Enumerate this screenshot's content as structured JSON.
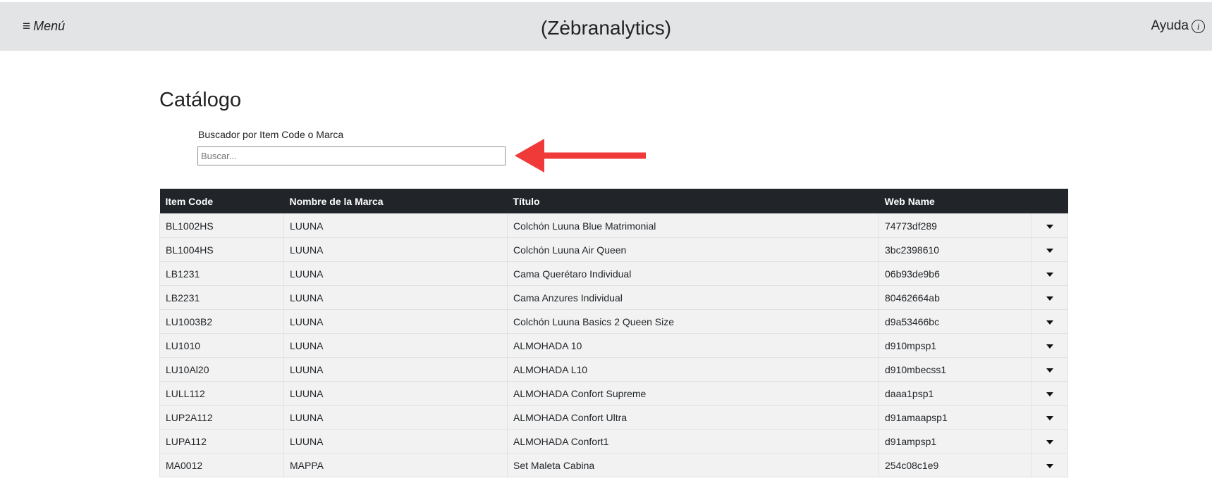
{
  "header": {
    "menu_icon": "hamburger-icon",
    "menu_label": "Menú",
    "brand": "(Zėbranalytics)",
    "help_label": "Ayuda",
    "help_icon": "info-circle-icon"
  },
  "page": {
    "title": "Catálogo"
  },
  "search": {
    "label": "Buscador por Item Code o Marca",
    "placeholder": "Buscar...",
    "value": ""
  },
  "annotation": {
    "arrow_color": "#f03a3a"
  },
  "table": {
    "columns": [
      "Item Code",
      "Nombre de la Marca",
      "Título",
      "Web Name"
    ],
    "rows": [
      {
        "item_code": "BL1002HS",
        "brand": "LUUNA",
        "title": "Colchón Luuna Blue Matrimonial",
        "web_name": "74773df289"
      },
      {
        "item_code": "BL1004HS",
        "brand": "LUUNA",
        "title": "Colchón Luuna Air Queen",
        "web_name": "3bc2398610"
      },
      {
        "item_code": "LB1231",
        "brand": "LUUNA",
        "title": "Cama Querétaro Individual",
        "web_name": "06b93de9b6"
      },
      {
        "item_code": "LB2231",
        "brand": "LUUNA",
        "title": "Cama Anzures Individual",
        "web_name": "80462664ab"
      },
      {
        "item_code": "LU1003B2",
        "brand": "LUUNA",
        "title": "Colchón Luuna Basics 2 Queen Size",
        "web_name": "d9a53466bc"
      },
      {
        "item_code": "LU1010",
        "brand": "LUUNA",
        "title": "ALMOHADA 10",
        "web_name": "d910mpsp1"
      },
      {
        "item_code": "LU10Al20",
        "brand": "LUUNA",
        "title": "ALMOHADA L10",
        "web_name": "d910mbecss1"
      },
      {
        "item_code": "LULL112",
        "brand": "LUUNA",
        "title": "ALMOHADA Confort Supreme",
        "web_name": "daaa1psp1"
      },
      {
        "item_code": "LUP2A112",
        "brand": "LUUNA",
        "title": "ALMOHADA Confort Ultra",
        "web_name": "d91amaapsp1"
      },
      {
        "item_code": "LUPA112",
        "brand": "LUUNA",
        "title": "ALMOHADA Confort1",
        "web_name": "d91ampsp1"
      },
      {
        "item_code": "MA0012",
        "brand": "MAPPA",
        "title": "Set Maleta Cabina",
        "web_name": "254c08c1e9"
      }
    ]
  }
}
